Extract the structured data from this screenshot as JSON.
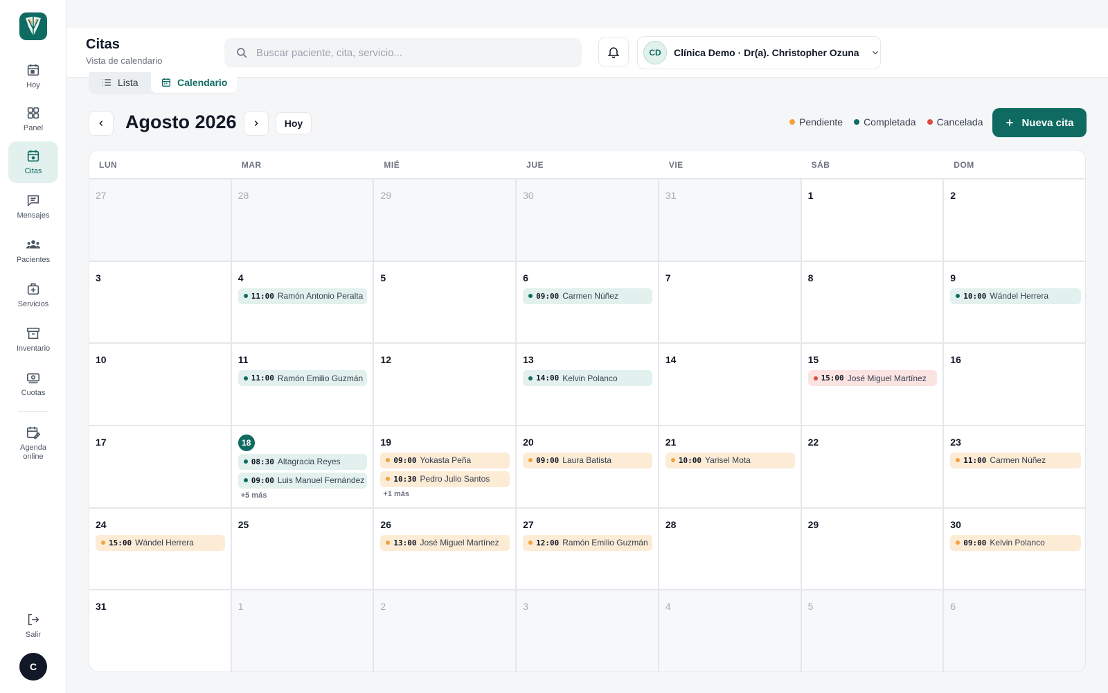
{
  "sidebar": {
    "items": [
      {
        "label": "Hoy",
        "icon": "calendar-today-icon"
      },
      {
        "label": "Panel",
        "icon": "grid-icon"
      },
      {
        "label": "Citas",
        "icon": "calendar-icon"
      },
      {
        "label": "Mensajes",
        "icon": "message-icon"
      },
      {
        "label": "Pacientes",
        "icon": "users-icon"
      },
      {
        "label": "Servicios",
        "icon": "medical-kit-icon"
      },
      {
        "label": "Inventario",
        "icon": "archive-icon"
      },
      {
        "label": "Cuotas",
        "icon": "money-icon"
      },
      {
        "label": "Agenda online",
        "icon": "calendar-edit-icon"
      }
    ],
    "logout_label": "Salir",
    "user_initial": "C"
  },
  "header": {
    "title": "Citas",
    "subtitle": "Vista de calendario",
    "search_placeholder": "Buscar paciente, cita, servicio...",
    "clinic_initials": "CD",
    "clinic_name": "Clínica Demo · Dr(a). Christopher Ozuna"
  },
  "view_toggle": {
    "list_label": "Lista",
    "calendar_label": "Calendario",
    "active": "Calendario"
  },
  "month": {
    "title": "Agosto 2026",
    "today_label": "Hoy"
  },
  "legend": [
    {
      "label": "Pendiente",
      "color": "#f2a23c"
    },
    {
      "label": "Completada",
      "color": "#0f6b62"
    },
    {
      "label": "Cancelada",
      "color": "#dc4b43"
    }
  ],
  "new_button_label": "Nueva cita",
  "colors": {
    "accent": "#0f6b62"
  },
  "weekdays": [
    "LUN",
    "MAR",
    "MIÉ",
    "JUE",
    "VIE",
    "SÁB",
    "DOM"
  ],
  "today_day": "18",
  "days": [
    {
      "day": "27",
      "other": true,
      "appts": []
    },
    {
      "day": "28",
      "other": true,
      "appts": []
    },
    {
      "day": "29",
      "other": true,
      "appts": []
    },
    {
      "day": "30",
      "other": true,
      "appts": []
    },
    {
      "day": "31",
      "other": true,
      "appts": []
    },
    {
      "day": "1",
      "other": false,
      "appts": []
    },
    {
      "day": "2",
      "other": false,
      "appts": []
    },
    {
      "day": "3",
      "other": false,
      "appts": []
    },
    {
      "day": "4",
      "other": false,
      "appts": [
        {
          "time": "11:00",
          "name": "Ramón Antonio Peralta",
          "status": "completada"
        }
      ]
    },
    {
      "day": "5",
      "other": false,
      "appts": []
    },
    {
      "day": "6",
      "other": false,
      "appts": [
        {
          "time": "09:00",
          "name": "Carmen Núñez",
          "status": "completada"
        }
      ]
    },
    {
      "day": "7",
      "other": false,
      "appts": []
    },
    {
      "day": "8",
      "other": false,
      "appts": []
    },
    {
      "day": "9",
      "other": false,
      "appts": [
        {
          "time": "10:00",
          "name": "Wándel Herrera",
          "status": "completada"
        }
      ]
    },
    {
      "day": "10",
      "other": false,
      "appts": []
    },
    {
      "day": "11",
      "other": false,
      "appts": [
        {
          "time": "11:00",
          "name": "Ramón Emilio Guzmán",
          "status": "completada"
        }
      ]
    },
    {
      "day": "12",
      "other": false,
      "appts": []
    },
    {
      "day": "13",
      "other": false,
      "appts": [
        {
          "time": "14:00",
          "name": "Kelvin Polanco",
          "status": "completada"
        }
      ]
    },
    {
      "day": "14",
      "other": false,
      "appts": []
    },
    {
      "day": "15",
      "other": false,
      "appts": [
        {
          "time": "15:00",
          "name": "José Miguel Martínez",
          "status": "cancelada"
        }
      ]
    },
    {
      "day": "16",
      "other": false,
      "appts": []
    },
    {
      "day": "17",
      "other": false,
      "appts": []
    },
    {
      "day": "18",
      "other": false,
      "appts": [
        {
          "time": "08:30",
          "name": "Altagracia Reyes",
          "status": "completada"
        },
        {
          "time": "09:00",
          "name": "Luis Manuel Fernández",
          "status": "completada"
        }
      ],
      "more": "+5 más"
    },
    {
      "day": "19",
      "other": false,
      "appts": [
        {
          "time": "09:00",
          "name": "Yokasta Peña",
          "status": "pendiente"
        },
        {
          "time": "10:30",
          "name": "Pedro Julio Santos",
          "status": "pendiente"
        }
      ],
      "more": "+1 más"
    },
    {
      "day": "20",
      "other": false,
      "appts": [
        {
          "time": "09:00",
          "name": "Laura Batista",
          "status": "pendiente"
        }
      ]
    },
    {
      "day": "21",
      "other": false,
      "appts": [
        {
          "time": "10:00",
          "name": "Yarisel Mota",
          "status": "pendiente"
        }
      ]
    },
    {
      "day": "22",
      "other": false,
      "appts": []
    },
    {
      "day": "23",
      "other": false,
      "appts": [
        {
          "time": "11:00",
          "name": "Carmen Núñez",
          "status": "pendiente"
        }
      ]
    },
    {
      "day": "24",
      "other": false,
      "appts": [
        {
          "time": "15:00",
          "name": "Wándel Herrera",
          "status": "pendiente"
        }
      ]
    },
    {
      "day": "25",
      "other": false,
      "appts": []
    },
    {
      "day": "26",
      "other": false,
      "appts": [
        {
          "time": "13:00",
          "name": "José Miguel Martínez",
          "status": "pendiente"
        }
      ]
    },
    {
      "day": "27",
      "other": false,
      "appts": [
        {
          "time": "12:00",
          "name": "Ramón Emilio Guzmán",
          "status": "pendiente"
        }
      ]
    },
    {
      "day": "28",
      "other": false,
      "appts": []
    },
    {
      "day": "29",
      "other": false,
      "appts": []
    },
    {
      "day": "30",
      "other": false,
      "appts": [
        {
          "time": "09:00",
          "name": "Kelvin Polanco",
          "status": "pendiente"
        }
      ]
    },
    {
      "day": "31",
      "other": false,
      "appts": []
    },
    {
      "day": "1",
      "other": true,
      "appts": []
    },
    {
      "day": "2",
      "other": true,
      "appts": []
    },
    {
      "day": "3",
      "other": true,
      "appts": []
    },
    {
      "day": "4",
      "other": true,
      "appts": []
    },
    {
      "day": "5",
      "other": true,
      "appts": []
    },
    {
      "day": "6",
      "other": true,
      "appts": []
    }
  ]
}
